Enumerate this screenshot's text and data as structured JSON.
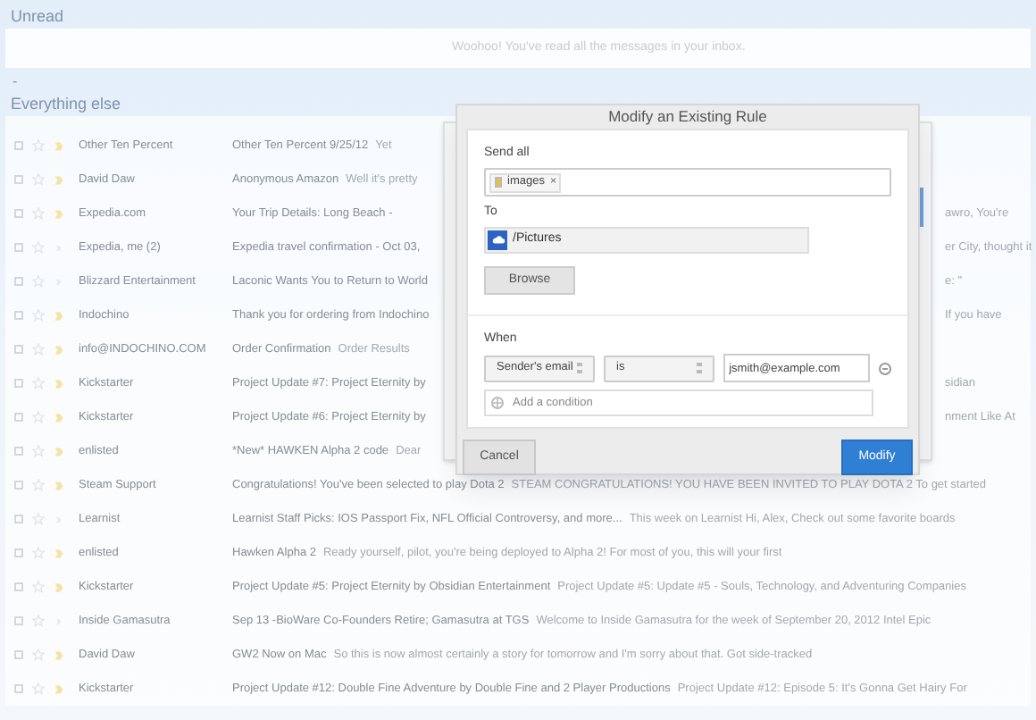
{
  "unread": {
    "heading": "Unread",
    "message": "Woohoo! You've read all the messages in your inbox."
  },
  "collapse_toggle": "-",
  "everything_else": {
    "heading": "Everything else",
    "rows": [
      {
        "checked": false,
        "important": true,
        "sender": "Other Ten Percent",
        "subject": "Other Ten Percent 9/25/12",
        "snippet": "Yet"
      },
      {
        "checked": false,
        "important": true,
        "sender": "David Daw",
        "subject": "Anonymous Amazon",
        "snippet": "Well it's pretty"
      },
      {
        "checked": false,
        "important": true,
        "sender": "Expedia.com",
        "subject": "Your Trip Details: Long Beach -",
        "tail": "awro, You're"
      },
      {
        "checked": false,
        "important": false,
        "sender": "Expedia, me (2)",
        "subject": "Expedia travel confirmation - Oct 03,",
        "tail": "er City, thought it"
      },
      {
        "checked": false,
        "important": false,
        "sender": "Blizzard Entertainment",
        "subject": "Laconic Wants You to Return to World",
        "tail": "e: \""
      },
      {
        "checked": false,
        "important": true,
        "sender": "Indochino",
        "subject": "Thank you for ordering from Indochino",
        "tail": "If you have"
      },
      {
        "checked": false,
        "important": true,
        "sender": "info@INDOCHINO.COM",
        "subject": "Order Confirmation",
        "snippet": "Order Results"
      },
      {
        "checked": false,
        "important": true,
        "sender": "Kickstarter",
        "subject": "Project Update #7: Project Eternity by",
        "tail": "sidian"
      },
      {
        "checked": false,
        "important": true,
        "sender": "Kickstarter",
        "subject": "Project Update #6: Project Eternity by",
        "tail": "nment Like At"
      },
      {
        "checked": false,
        "important": true,
        "sender": "enlisted",
        "subject": "*New* HAWKEN Alpha 2 code",
        "snippet": "Dear"
      },
      {
        "checked": false,
        "important": true,
        "sender": "Steam Support",
        "subject": "Congratulations! You've been selected to play Dota 2",
        "snippet": "STEAM CONGRATULATIONS! YOU HAVE BEEN INVITED TO PLAY DOTA 2 To get started"
      },
      {
        "checked": false,
        "important": false,
        "sender": "Learnist",
        "subject": "Learnist Staff Picks: IOS Passport Fix, NFL Official Controversy, and more...",
        "snippet": "This week on Learnist Hi, Alex, Check out some favorite boards"
      },
      {
        "checked": false,
        "important": true,
        "sender": "enlisted",
        "subject": "Hawken Alpha 2",
        "snippet": "Ready yourself, pilot, you're being deployed to Alpha 2! For most of you, this will your first"
      },
      {
        "checked": false,
        "important": true,
        "sender": "Kickstarter",
        "subject": "Project Update #5: Project Eternity by Obsidian Entertainment",
        "snippet": "Project Update #5: Update #5 - Souls, Technology, and Adventuring Companies"
      },
      {
        "checked": false,
        "important": false,
        "sender": "Inside Gamasutra",
        "subject": "Sep 13 -BioWare Co-Founders Retire; Gamasutra at TGS",
        "snippet": "Welcome to Inside Gamasutra for the week of September 20, 2012 Intel Epic"
      },
      {
        "checked": false,
        "important": true,
        "sender": "David Daw",
        "subject": "GW2 Now on Mac",
        "snippet": "So this is now almost certainly a story for tomorrow and I'm sorry about that. Got side-tracked"
      },
      {
        "checked": false,
        "important": true,
        "sender": "Kickstarter",
        "subject": "Project Update #12: Double Fine Adventure by Double Fine and 2 Player Productions",
        "snippet": "Project Update #12: Episode 5: It's Gonna Get Hairy For"
      }
    ]
  },
  "dialog": {
    "title": "Modify an Existing Rule",
    "send_all_label": "Send all",
    "tag": "images",
    "tag_remove": "×",
    "to_label": "To",
    "destination": "/Pictures",
    "browse": "Browse",
    "when_label": "When",
    "field_select": "Sender's email",
    "operator_select": "is",
    "value": "jsmith@example.com",
    "add_condition_placeholder": "Add a condition",
    "cancel": "Cancel",
    "modify": "Modify"
  }
}
